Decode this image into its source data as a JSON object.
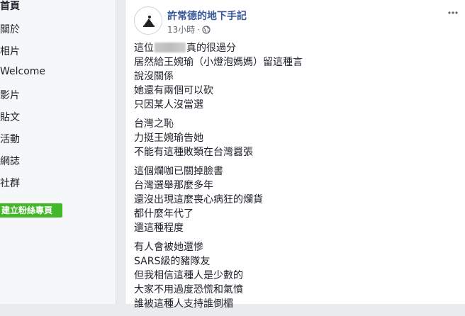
{
  "sidebar": {
    "items": [
      {
        "label": "首頁",
        "active": true
      },
      {
        "label": "關於",
        "active": false
      },
      {
        "label": "相片",
        "active": false
      },
      {
        "label": "Welcome",
        "active": false
      },
      {
        "label": "影片",
        "active": false
      },
      {
        "label": "貼文",
        "active": false
      },
      {
        "label": "活動",
        "active": false
      },
      {
        "label": "網誌",
        "active": false
      },
      {
        "label": "社群",
        "active": false
      }
    ],
    "create_button": "建立粉絲專頁"
  },
  "post": {
    "page_name": "許常德的地下手記",
    "time": "13小時",
    "separator": "·",
    "paragraphs": [
      {
        "lines": [
          {
            "before": "這位",
            "after": "真的很過分",
            "redacted": true
          },
          {
            "text": "居然給王婉瑜（小燈泡媽媽）留這種言"
          },
          {
            "text": "說沒關係"
          },
          {
            "text": "她還有兩個可以砍"
          },
          {
            "text": "只因某人沒當選"
          }
        ]
      },
      {
        "lines": [
          {
            "text": "台灣之恥"
          },
          {
            "text": "力挺王婉瑜告她"
          },
          {
            "text": "不能有這種敗類在台灣囂張"
          }
        ]
      },
      {
        "lines": [
          {
            "text": "這個爛咖已關掉臉書"
          },
          {
            "text": "台灣選舉那麼多年"
          },
          {
            "text": "還沒出現這麼喪心病狂的爛貨"
          },
          {
            "text": "都什麼年代了"
          },
          {
            "text": "還這種程度"
          }
        ]
      },
      {
        "lines": [
          {
            "text": "有人會被她還慘"
          },
          {
            "text": "SARS級的豬隊友"
          },
          {
            "text": "但我相信這種人是少數的"
          },
          {
            "text": "大家不用過度恐慌和氣憤"
          },
          {
            "text": "誰被這種人支持誰倒楣"
          }
        ]
      }
    ]
  },
  "colors": {
    "link": "#385898",
    "background": "#e9ebee",
    "create_button": "#42b72a"
  }
}
